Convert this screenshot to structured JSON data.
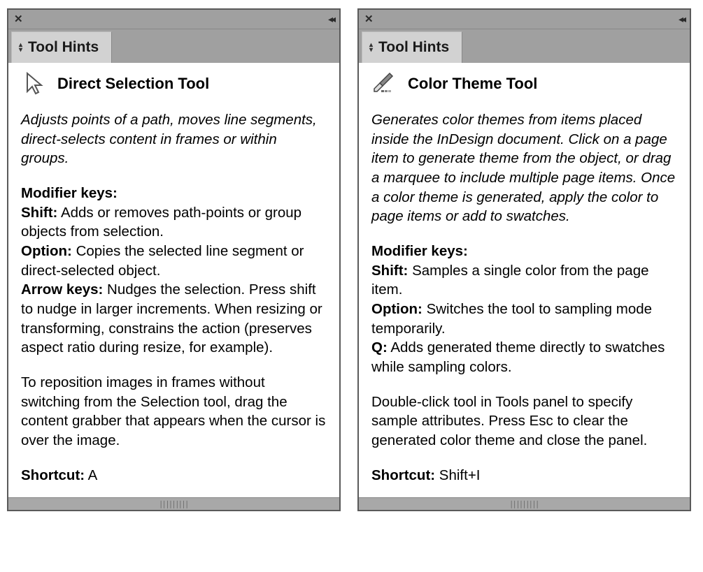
{
  "panels": [
    {
      "tab_label": "Tool Hints",
      "tool_title": "Direct Selection Tool",
      "description": "Adjusts points of a path, moves line segments, direct-selects content in frames or within groups.",
      "modifier_heading": "Modifier keys:",
      "modifiers": [
        {
          "key": "Shift:",
          "text": " Adds or removes path-points or group objects from selection."
        },
        {
          "key": "Option:",
          "text": " Copies the selected line segment or direct-selected object."
        },
        {
          "key": "Arrow keys:",
          "text": " Nudges the selection. Press shift to nudge in larger increments. When resizing or transforming, constrains the action (preserves aspect ratio during resize, for example)."
        }
      ],
      "extra_text": "To reposition images in frames without switching from the Selection tool, drag the content grabber that appears when the cursor is over the image.",
      "shortcut_label": "Shortcut:",
      "shortcut_value": " A"
    },
    {
      "tab_label": "Tool Hints",
      "tool_title": "Color Theme Tool",
      "description": "Generates color themes from items placed inside the InDesign document. Click on a page item to generate theme from the object, or drag a marquee to include multiple page items. Once a color theme is generated, apply the color to page items or add to swatches.",
      "modifier_heading": "Modifier keys:",
      "modifiers": [
        {
          "key": "Shift:",
          "text": " Samples a single color from the page item."
        },
        {
          "key": "Option:",
          "text": " Switches the tool to sampling mode temporarily."
        },
        {
          "key": "Q:",
          "text": " Adds generated theme directly to swatches while sampling colors."
        }
      ],
      "extra_text": "Double-click tool in Tools panel to specify sample attributes. Press Esc to clear the generated color theme and close the panel.",
      "shortcut_label": "Shortcut:",
      "shortcut_value": " Shift+I"
    }
  ]
}
